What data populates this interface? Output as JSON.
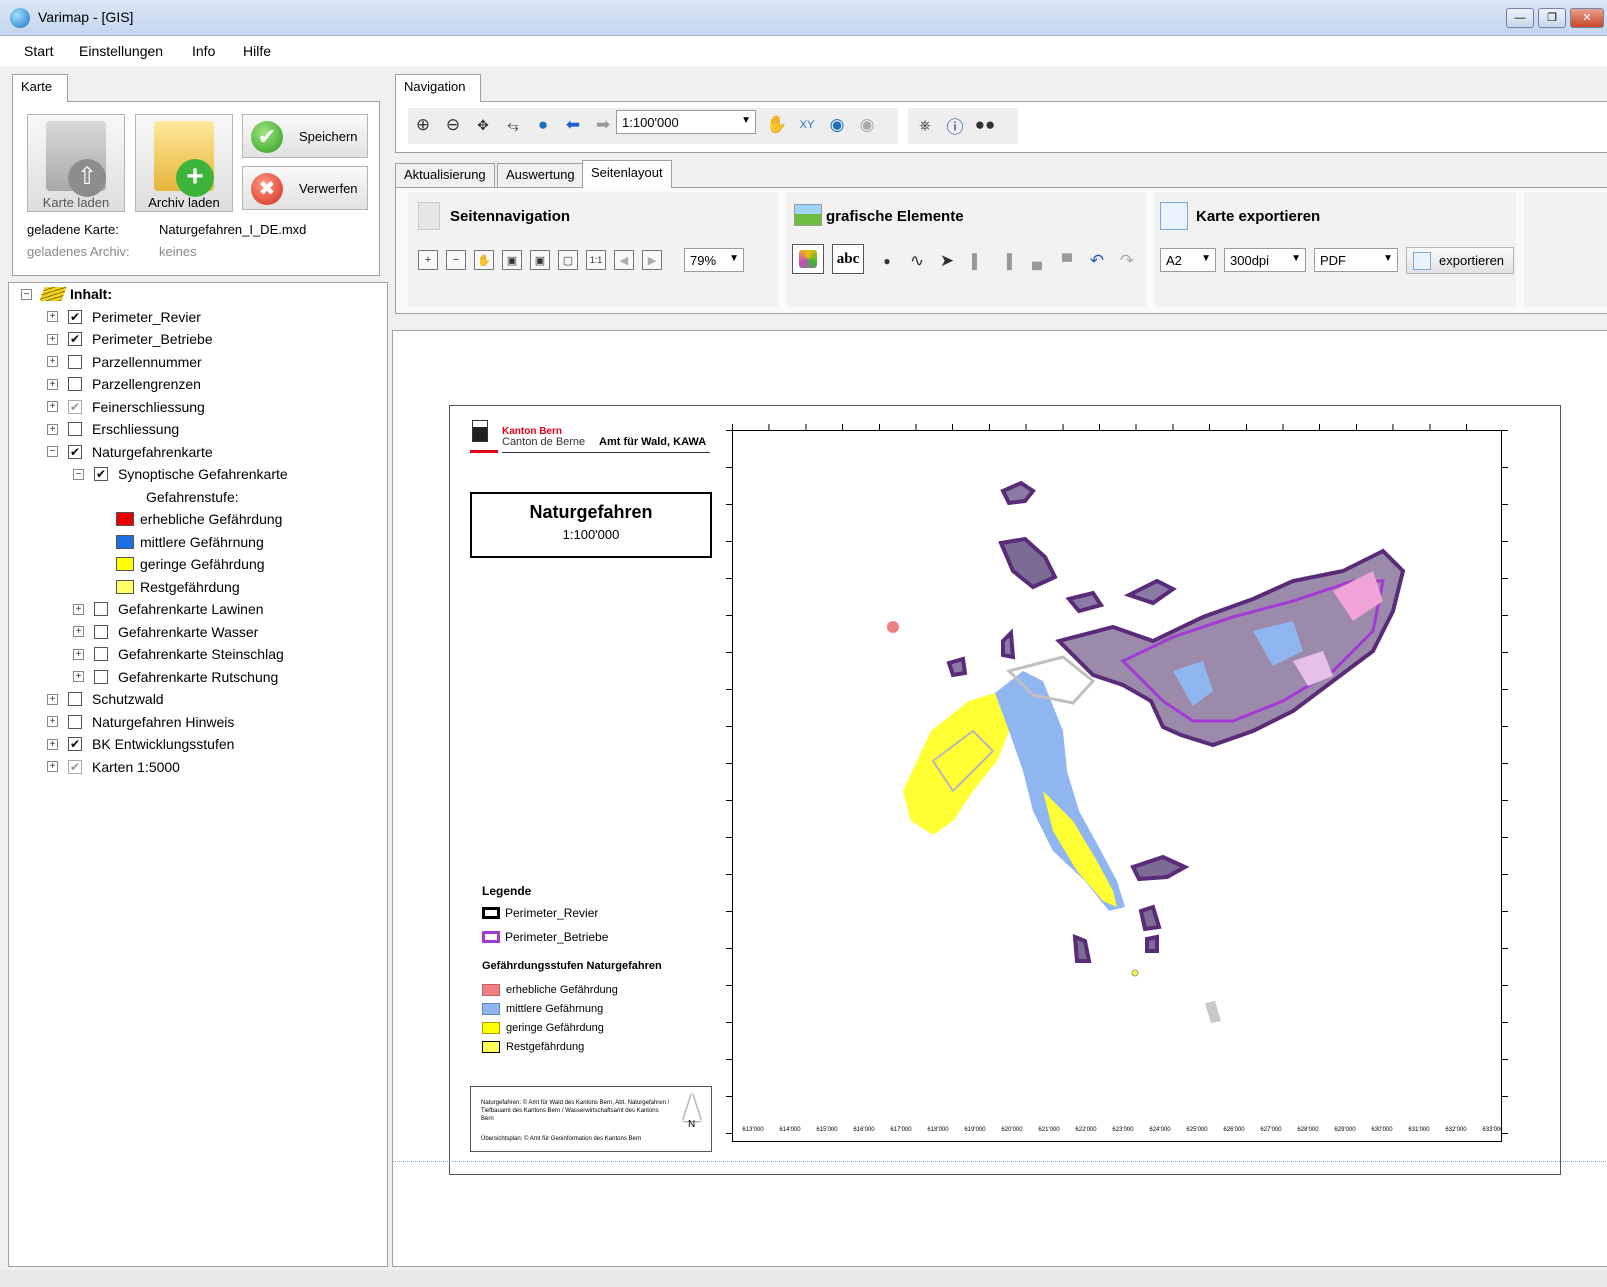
{
  "window": {
    "title": "Varimap - [GIS]"
  },
  "menu": {
    "items": [
      "Start",
      "Einstellungen",
      "Info",
      "Hilfe"
    ]
  },
  "left": {
    "tab_label": "Karte",
    "btn_load_map": "Karte laden",
    "btn_load_archive": "Archiv laden",
    "btn_save": "Speichern",
    "btn_discard": "Verwerfen",
    "loaded_map_label": "geladene Karte:",
    "loaded_map_value": "Naturgefahren_I_DE.mxd",
    "loaded_archive_label": "geladenes Archiv:",
    "loaded_archive_value": "keines"
  },
  "tree": {
    "root": "Inhalt:",
    "items": [
      "Perimeter_Revier",
      "Perimeter_Betriebe",
      "Parzellennummer",
      "Parzellengrenzen",
      "Feinerschliessung",
      "Erschliessung",
      "Naturgefahrenkarte",
      "Synoptische Gefahrenkarte",
      "Gefahrenstufe:",
      "erhebliche Gefährdung",
      "mittlere Gefährnung",
      "geringe Gefährdung",
      "Restgefährdung",
      "Gefahrenkarte Lawinen",
      "Gefahrenkarte Wasser",
      "Gefahrenkarte Steinschlag",
      "Gefahrenkarte Rutschung",
      "Schutzwald",
      "Naturgefahren Hinweis",
      "BK Entwicklungsstufen",
      "Karten 1:5000"
    ],
    "colors": {
      "red": "#e60000",
      "blue": "#1e6fe6",
      "yellow": "#ffff00",
      "yellow_light": "#ffff66"
    }
  },
  "navigation": {
    "tab_label": "Navigation",
    "scale_value": "1:100'000"
  },
  "ribbon": {
    "tabs": [
      "Aktualisierung",
      "Auswertung",
      "Seitenlayout"
    ],
    "group_pagenav": "Seitennavigation",
    "group_graphics": "grafische Elemente",
    "group_export": "Karte exportieren",
    "zoom_value": "79%",
    "paper_value": "A2",
    "dpi_value": "300dpi",
    "format_value": "PDF",
    "export_button": "exportieren",
    "abc_label": "abc"
  },
  "layout": {
    "canton_name": "Kanton Bern",
    "canton_name_fr": "Canton de Berne",
    "office": "Amt für Wald, KAWA",
    "map_title": "Naturgefahren",
    "map_scale": "1:100'000",
    "legend_title": "Legende",
    "legend_perimeter_revier": "Perimeter_Revier",
    "legend_perimeter_betriebe": "Perimeter_Betriebe",
    "hazard_title": "Gefährdungsstufen Naturgefahren",
    "hazard_items": [
      "erhebliche Gefährdung",
      "mittlere Gefährnung",
      "geringe Gefährdung",
      "Restgefährdung"
    ],
    "credit_line1": "Naturgefahren: © Amt für Wald des Kantons Bern, Abt. Naturgefahren / Tiefbauamt des Kantons Bern / Wasserwirtschaftsamt des Kantons Bern",
    "credit_line2": "Übersichtsplan: © Amt für Geoinformation des Kantons Bern",
    "north_label": "N",
    "x_ticks": [
      "613'000",
      "614'000",
      "615'000",
      "616'000",
      "617'000",
      "618'000",
      "619'000",
      "620'000",
      "621'000",
      "622'000",
      "623'000",
      "624'000",
      "625'000",
      "626'000",
      "627'000",
      "628'000",
      "629'000",
      "630'000",
      "631'000",
      "632'000",
      "633'000"
    ],
    "hazard_colors": {
      "erheblich": "#f08080",
      "mittel": "#8fb6f0",
      "gering": "#ffff00",
      "rest": "#ffff55"
    },
    "perimeter_colors": {
      "revier": "#000000",
      "betriebe": "#a33ad6"
    }
  }
}
